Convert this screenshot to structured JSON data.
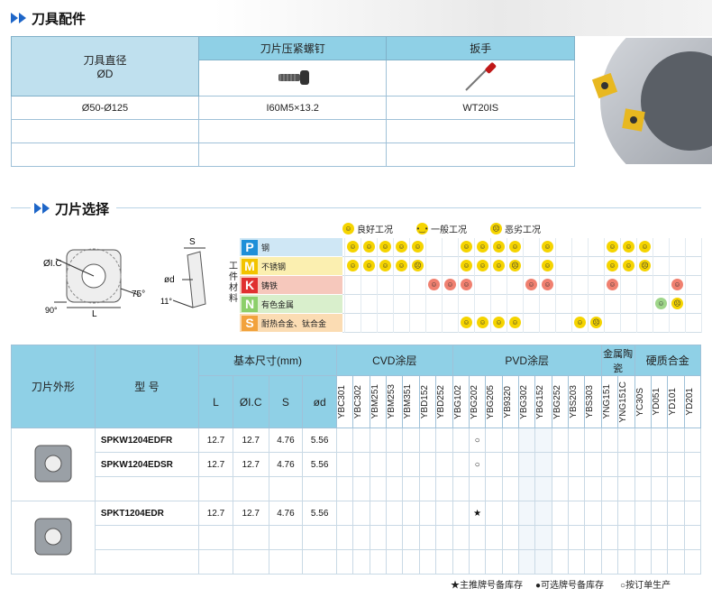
{
  "section1": {
    "title": "刀具配件"
  },
  "accessories": {
    "headers": {
      "dia": "刀具直径",
      "dia_sub": "ØD",
      "screw": "刀片压紧螺钉",
      "wrench": "扳手"
    },
    "rows": [
      {
        "dia": "Ø50-Ø125",
        "screw": "I60M5×13.2",
        "wrench": "WT20IS"
      }
    ]
  },
  "section2": {
    "title": "刀片选择"
  },
  "legend": {
    "good": "良好工况",
    "normal": "一般工况",
    "bad": "恶劣工况"
  },
  "diagram": {
    "ic": "ØI.C",
    "l": "L",
    "s": "S",
    "d": "ød",
    "a90": "90°",
    "a75": "75°",
    "a11": "11°",
    "work_material": "工件材料"
  },
  "materials": [
    {
      "letter": "P",
      "name": "钢",
      "color": "#1e8fd8",
      "bg": "#cfe7f5"
    },
    {
      "letter": "M",
      "name": "不锈钢",
      "color": "#f2c300",
      "bg": "#fbefb0"
    },
    {
      "letter": "K",
      "name": "铸铁",
      "color": "#e03030",
      "bg": "#f6c8bc"
    },
    {
      "letter": "N",
      "name": "有色金属",
      "color": "#8ccf6a",
      "bg": "#d9efcc"
    },
    {
      "letter": "S",
      "name": "耐热合金、钛合金",
      "color": "#f2a23c",
      "bg": "#fbdcb3"
    }
  ],
  "table": {
    "h_shape": "刀片外形",
    "h_model": "型 号",
    "h_dims": "基本尺寸(mm)",
    "h_L": "L",
    "h_IC": "ØI.C",
    "h_S": "S",
    "h_d": "ød",
    "h_cvd": "CVD涂层",
    "h_pvd": "PVD涂层",
    "h_cermet": "金属陶瓷",
    "h_carbide": "硬质合金",
    "grades": [
      "YBC301",
      "YBC302",
      "YBM251",
      "YBM253",
      "YBM351",
      "YBD152",
      "YBD252",
      "YBG102",
      "YBG202",
      "YBG205",
      "YB9320",
      "YBG302",
      "YBG152",
      "YBG252",
      "YBS203",
      "YBS303",
      "YNG151",
      "YNG151C",
      "YC30S",
      "YD051",
      "YD101",
      "YD201"
    ],
    "rows": [
      {
        "model": "SPKW1204EDFR",
        "L": "12.7",
        "IC": "12.7",
        "S": "4.76",
        "d": "5.56",
        "mark": "○"
      },
      {
        "model": "SPKW1204EDSR",
        "L": "12.7",
        "IC": "12.7",
        "S": "4.76",
        "d": "5.56",
        "mark": "○"
      },
      {
        "model": "SPKT1204EDR",
        "L": "12.7",
        "IC": "12.7",
        "S": "4.76",
        "d": "5.56",
        "mark": "★"
      }
    ]
  },
  "footer": {
    "star": "★主推牌号备库存",
    "dot": "●可选牌号备库存",
    "circle": "○按订单生产"
  }
}
